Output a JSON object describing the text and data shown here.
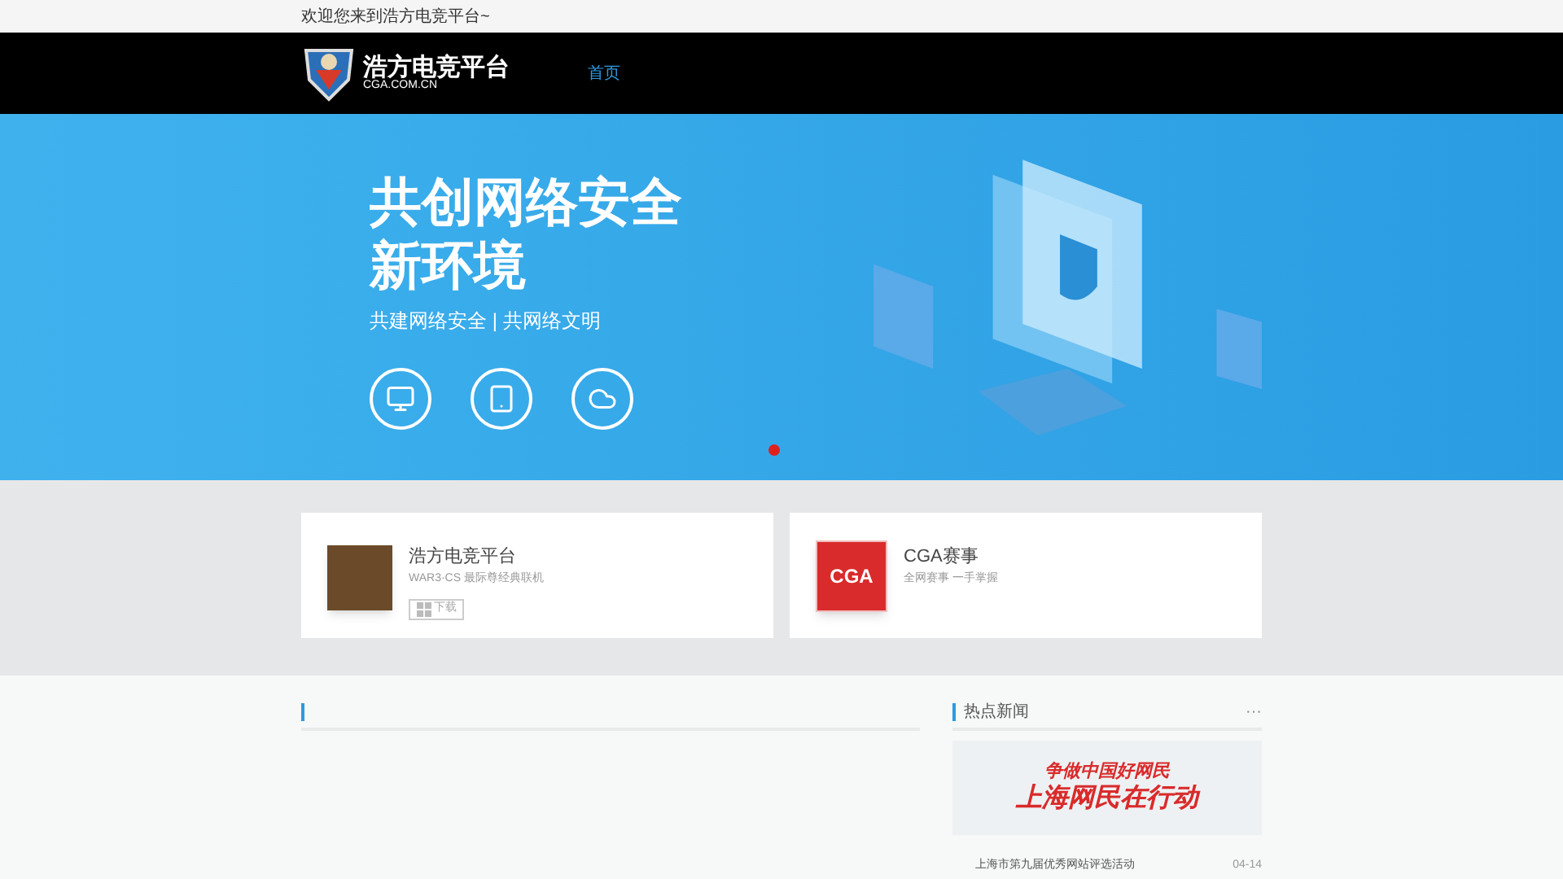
{
  "top_bar": {
    "welcome": "欢迎您来到浩方电竞平台~"
  },
  "header": {
    "logo_text": "浩方电竞平台",
    "logo_sub": "CGA.COM.CN",
    "nav": [
      {
        "label": "首页",
        "selected": true
      }
    ]
  },
  "banner": {
    "headline_1": "共创网络安全",
    "headline_2": "新环境",
    "subtitle": "共建网络安全 | 共网络文明",
    "slides": [
      {
        "selected": true
      }
    ]
  },
  "products": [
    {
      "kind": "game",
      "title": "浩方电竞平台",
      "desc": "WAR3·CS 最际尊经典联机",
      "button": "下载"
    },
    {
      "kind": "event",
      "title": "CGA赛事",
      "desc": "全网赛事 一手掌握",
      "logo_text": "CGA"
    }
  ],
  "hot_news": {
    "title": "热点新闻",
    "more": "···",
    "banner_line_1": "争做中国好网民",
    "banner_line_2": "上海网民在行动",
    "items": [
      {
        "title": "上海市第九届优秀网站评选活动",
        "date": "04-14"
      }
    ]
  }
}
